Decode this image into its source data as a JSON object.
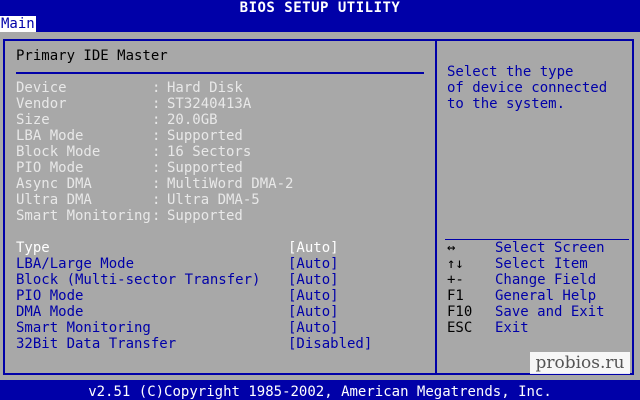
{
  "app": {
    "title": "BIOS SETUP UTILITY",
    "active_tab": "Main"
  },
  "section": {
    "title": "Primary IDE Master"
  },
  "info": [
    {
      "label": "Device",
      "value": "Hard Disk"
    },
    {
      "label": "Vendor",
      "value": "ST3240413A"
    },
    {
      "label": "Size",
      "value": "20.0GB"
    },
    {
      "label": "LBA Mode",
      "value": "Supported"
    },
    {
      "label": "Block Mode",
      "value": "16 Sectors"
    },
    {
      "label": "PIO Mode",
      "value": "Supported"
    },
    {
      "label": "Async DMA",
      "value": "MultiWord DMA-2"
    },
    {
      "label": "Ultra DMA",
      "value": "Ultra DMA-5"
    },
    {
      "label": "Smart Monitoring",
      "value": "Supported"
    }
  ],
  "settings": [
    {
      "label": "Type",
      "value": "[Auto]",
      "selected": true
    },
    {
      "label": "LBA/Large Mode",
      "value": "[Auto]"
    },
    {
      "label": "Block (Multi-sector Transfer)",
      "value": "[Auto]"
    },
    {
      "label": "PIO Mode",
      "value": "[Auto]"
    },
    {
      "label": "DMA Mode",
      "value": "[Auto]"
    },
    {
      "label": "Smart Monitoring",
      "value": "[Auto]"
    },
    {
      "label": "32Bit Data Transfer",
      "value": "[Disabled]"
    }
  ],
  "help": {
    "lines": [
      "Select the type",
      "of device connected",
      "to the system."
    ]
  },
  "keys": [
    {
      "key": "↔",
      "desc": "Select Screen"
    },
    {
      "key": "↑↓",
      "desc": "Select Item"
    },
    {
      "key": "+-",
      "desc": "Change Field"
    },
    {
      "key": "F1",
      "desc": "General Help"
    },
    {
      "key": "F10",
      "desc": "Save and Exit"
    },
    {
      "key": "ESC",
      "desc": "Exit"
    }
  ],
  "watermark": "probios.ru",
  "footer": "v2.51 (C)Copyright 1985-2002, American Megatrends, Inc.",
  "colors": {
    "bios_blue": "#0000a8",
    "panel_grey": "#a8a8a8",
    "info_text": "#e8e8e8",
    "selected_text": "#ffffff"
  }
}
